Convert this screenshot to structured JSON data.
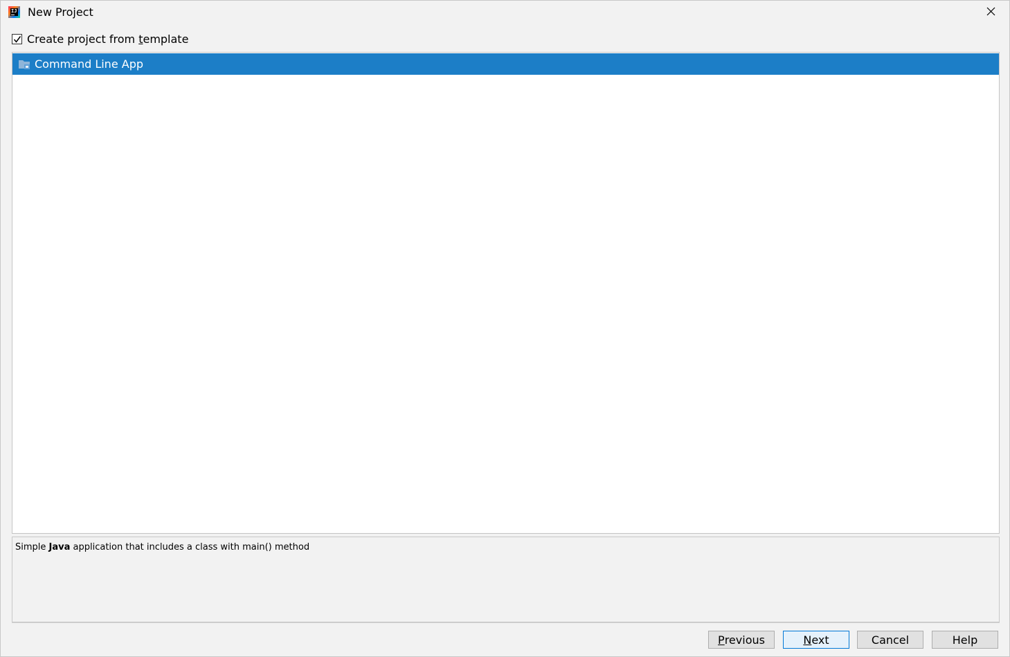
{
  "window": {
    "title": "New Project",
    "app_icon": "intellij-idea-icon",
    "close_icon": "close-icon"
  },
  "template_checkbox": {
    "label_before": "Create project from ",
    "label_mnemonic": "t",
    "label_after": "emplate",
    "checked": true
  },
  "templates": {
    "items": [
      {
        "label": "Command Line App",
        "icon": "folder-icon",
        "selected": true
      }
    ],
    "selected_color": "#1c7ec7"
  },
  "description": {
    "prefix": "Simple ",
    "bold": "Java",
    "suffix": " application that includes a class with main() method"
  },
  "buttons": {
    "previous": {
      "mnemonic": "P",
      "rest": "revious"
    },
    "next": {
      "mnemonic": "N",
      "rest": "ext"
    },
    "cancel": {
      "label": "Cancel"
    },
    "help": {
      "label": "Help"
    }
  }
}
